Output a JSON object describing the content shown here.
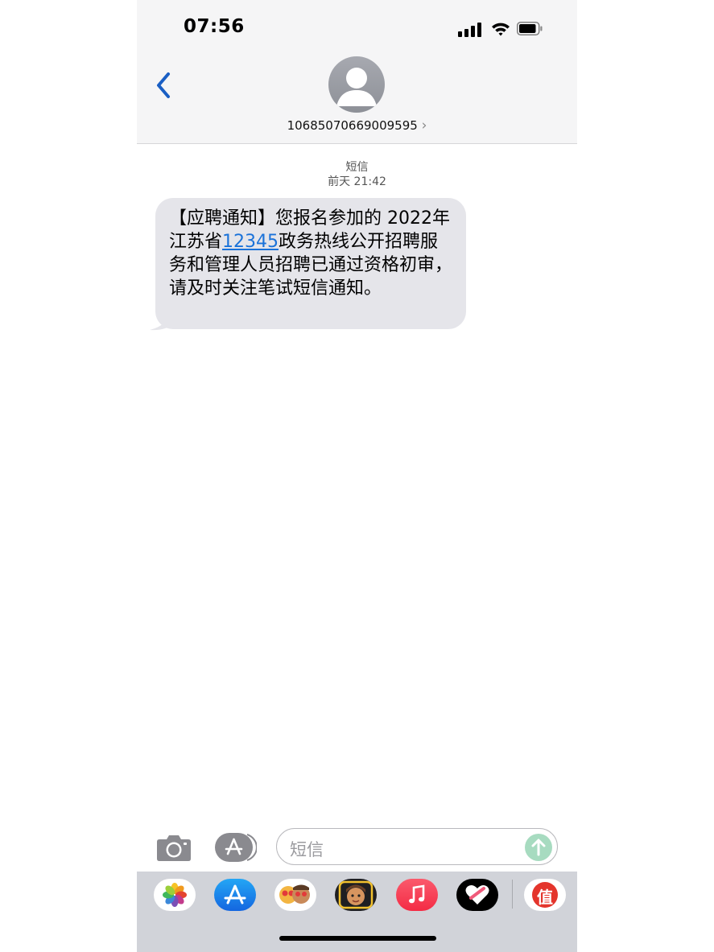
{
  "status_bar": {
    "time": "07:56"
  },
  "header": {
    "contact": "10685070669009595",
    "chevron": "›"
  },
  "conversation": {
    "service_label": "短信",
    "timestamp": "前天 21:42",
    "message": {
      "text_before": "【应聘通知】您报名参加的 2022年江苏省",
      "link": "12345",
      "text_after": "政务热线公开招聘服务和管理人员招聘已通过资格初审，请及时关注笔试短信通知。"
    }
  },
  "input": {
    "placeholder": "短信"
  },
  "icons": {
    "back": "chevron-left-icon",
    "camera": "camera-icon",
    "apps": "app-store-icon",
    "send": "arrow-up-icon",
    "drawer": [
      "photos-icon",
      "app-store-icon",
      "memoji-stickers-icon",
      "memoji-icon",
      "music-icon",
      "digital-touch-icon",
      "zhi-app-icon"
    ]
  },
  "drawer": {
    "zhi_label": "值"
  },
  "colors": {
    "accent": "#1a72d9",
    "bubble": "#e5e5ea",
    "send": "#a7dbc0",
    "music": "#fa2e47",
    "zhi": "#e4352c"
  }
}
